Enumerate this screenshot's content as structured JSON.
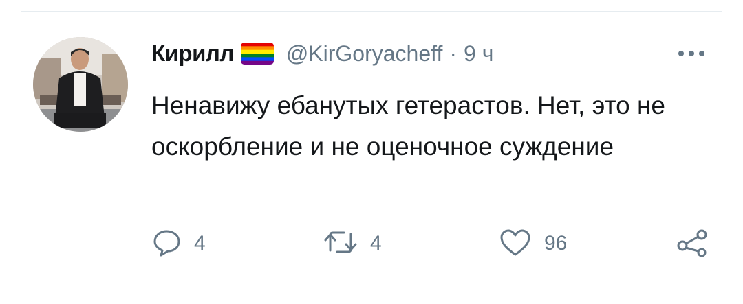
{
  "tweet": {
    "author_name": "Кирилл",
    "handle": "@KirGoryacheff",
    "separator": "·",
    "time": "9 ч",
    "text": "Ненавижу ебанутых гетерастов. Нет, это не оскорбление и не оценочное суждение",
    "badge_icon": "rainbow-flag-icon",
    "more_icon": "more-dots-icon"
  },
  "actions": {
    "reply_count": "4",
    "retweet_count": "4",
    "like_count": "96",
    "reply_icon": "reply-icon",
    "retweet_icon": "retweet-icon",
    "like_icon": "heart-icon",
    "share_icon": "share-icon"
  },
  "colors": {
    "text_primary": "#14171a",
    "text_secondary": "#657786",
    "divider": "#e6ecf0",
    "flag": [
      "#e40303",
      "#ff8c00",
      "#ffed00",
      "#008026",
      "#004dff",
      "#750787"
    ]
  }
}
